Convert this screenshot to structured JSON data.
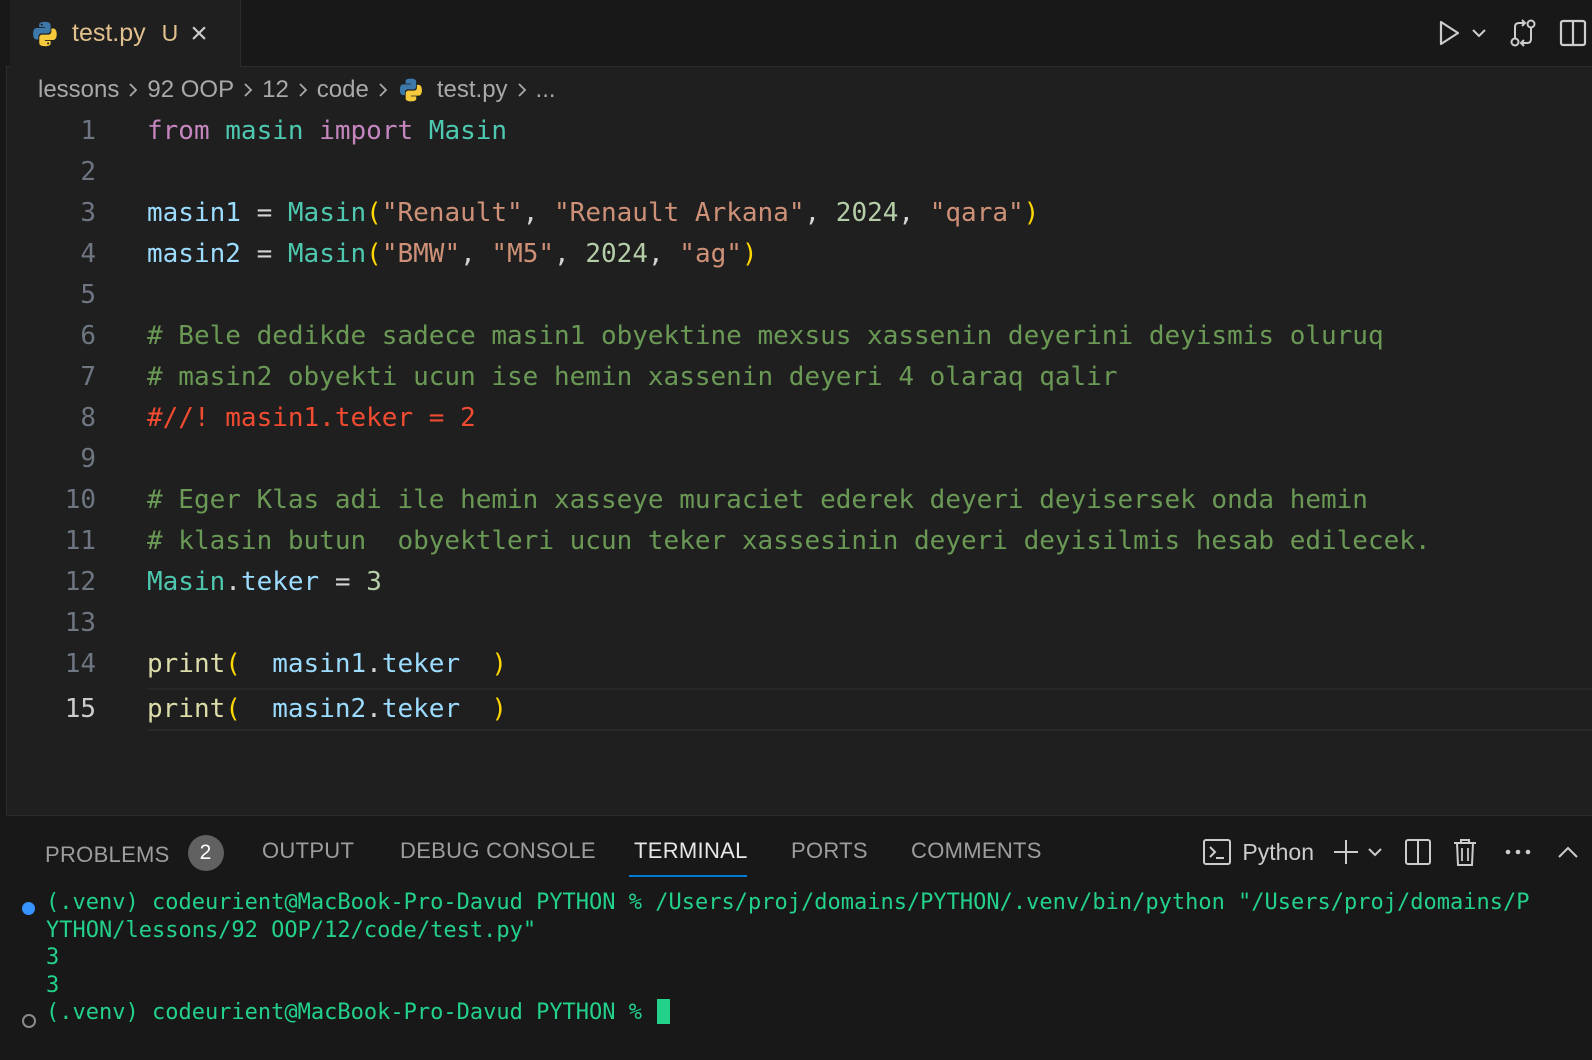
{
  "tab": {
    "filename": "test.py",
    "status": "U",
    "close": "×"
  },
  "breadcrumb": [
    "lessons",
    "92 OOP",
    "12",
    "code",
    "test.py",
    "..."
  ],
  "editor": {
    "line_numbers": [
      "1",
      "2",
      "3",
      "4",
      "5",
      "6",
      "7",
      "8",
      "9",
      "10",
      "11",
      "12",
      "13",
      "14",
      "15"
    ],
    "active_line": "15",
    "lines": {
      "l1": {
        "from": "from",
        "mod": "masin",
        "import": "import",
        "cls": "Masin"
      },
      "l3": {
        "var": "masin1",
        "eq": " = ",
        "cls": "Masin",
        "open": "(",
        "s1": "\"Renault\"",
        "c1": ", ",
        "s2": "\"Renault Arkana\"",
        "c2": ", ",
        "n": "2024",
        "c3": ", ",
        "s3": "\"qara\"",
        "close": ")"
      },
      "l4": {
        "var": "masin2",
        "eq": " = ",
        "cls": "Masin",
        "open": "(",
        "s1": "\"BMW\"",
        "c1": ", ",
        "s2": "\"M5\"",
        "c2": ", ",
        "n": "2024",
        "c3": ", ",
        "s3": "\"ag\"",
        "close": ")"
      },
      "l6": "# Bele dedikde sadece masin1 obyektine mexsus xassenin deyerini deyismis oluruq",
      "l7": "# masin2 obyekti ucun ise hemin xassenin deyeri 4 olaraq qalir",
      "l8": "#//! masin1.teker = 2",
      "l10": "# Eger Klas adi ile hemin xasseye muraciet ederek deyeri deyisersek onda hemin",
      "l11": "# klasin butun  obyektleri ucun teker xassesinin deyeri deyisilmis hesab edilecek.",
      "l12": {
        "cls": "Masin",
        "dot": ".",
        "attr": "teker",
        "eq": " = ",
        "num": "3"
      },
      "l14": {
        "fn": "print",
        "open": "(",
        "pad1": "  ",
        "var": "masin1",
        "dot": ".",
        "attr": "teker",
        "pad2": "  ",
        "close": ")"
      },
      "l15": {
        "fn": "print",
        "open": "(",
        "pad1": "  ",
        "var": "masin2",
        "dot": ".",
        "attr": "teker",
        "pad2": "  ",
        "close": ")"
      }
    }
  },
  "panel": {
    "tabs": {
      "problems": "PROBLEMS",
      "problems_count": "2",
      "output": "OUTPUT",
      "debug_console": "DEBUG CONSOLE",
      "terminal": "TERMINAL",
      "ports": "PORTS",
      "comments": "COMMENTS"
    },
    "active_tab": "TERMINAL",
    "shell_name": "Python"
  },
  "terminal": {
    "line1": "(.venv) codeurient@MacBook-Pro-Davud PYTHON % /Users/proj/domains/PYTHON/.venv/bin/python \"/Users/proj/domains/P",
    "line2": "YTHON/lessons/92 OOP/12/code/test.py\"",
    "out1": "3",
    "out2": "3",
    "prompt": "(.venv) codeurient@MacBook-Pro-Davud PYTHON % "
  },
  "colors": {
    "editor_bg": "#1f1f1f",
    "panel_bg": "#181818",
    "accent": "#0078d4",
    "terminal_green": "#23d18b",
    "tab_modified": "#e2c08d"
  },
  "icons": [
    "python-file-icon",
    "close-icon",
    "run-icon",
    "chevron-down-icon",
    "compare-changes-icon",
    "split-editor-icon",
    "terminal-icon",
    "plus-icon",
    "trash-icon",
    "more-icon",
    "chevron-up-icon"
  ]
}
